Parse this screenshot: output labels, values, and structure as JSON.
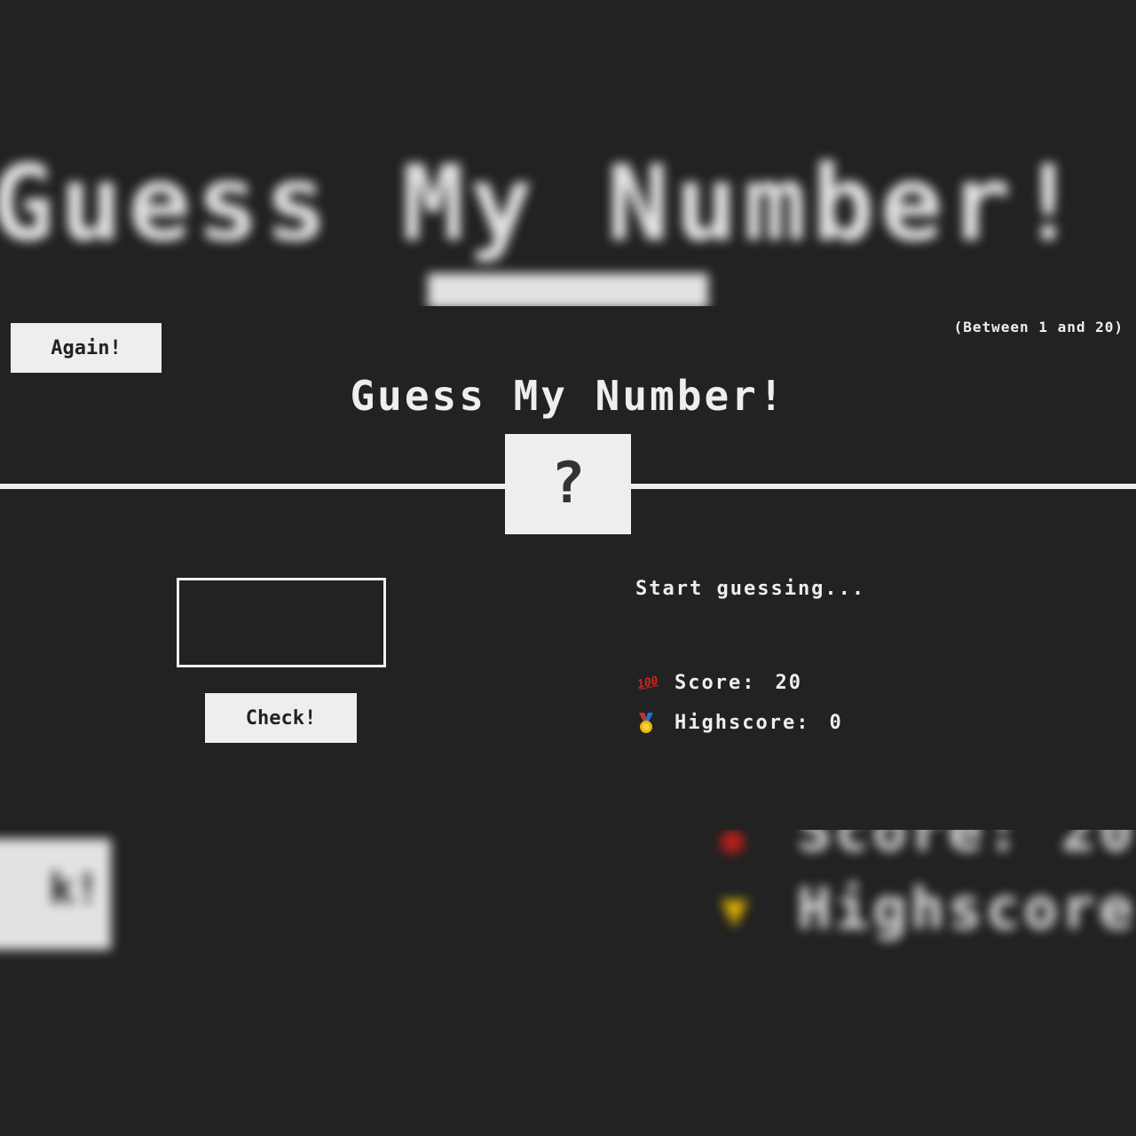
{
  "background_zoom": {
    "title": "Guess My Number!",
    "check_fragment": "k!",
    "score_fragment": "Score: 20",
    "highscore_fragment": "Highscore"
  },
  "header": {
    "again_label": "Again!",
    "between_label": "(Between 1 and 20)",
    "title": "Guess My Number!",
    "secret_number": "?"
  },
  "left": {
    "guess_value": "",
    "check_label": "Check!"
  },
  "right": {
    "message": "Start guessing...",
    "score_label": "Score:",
    "score_value": "20",
    "highscore_label": "Highscore:",
    "highscore_value": "0",
    "score_icon": "hundred-points-icon",
    "highscore_icon": "medal-icon"
  },
  "colors": {
    "background": "#222222",
    "foreground": "#eeeeee",
    "hundred_red": "#d0251c",
    "medal_gold": "#e6b800"
  }
}
